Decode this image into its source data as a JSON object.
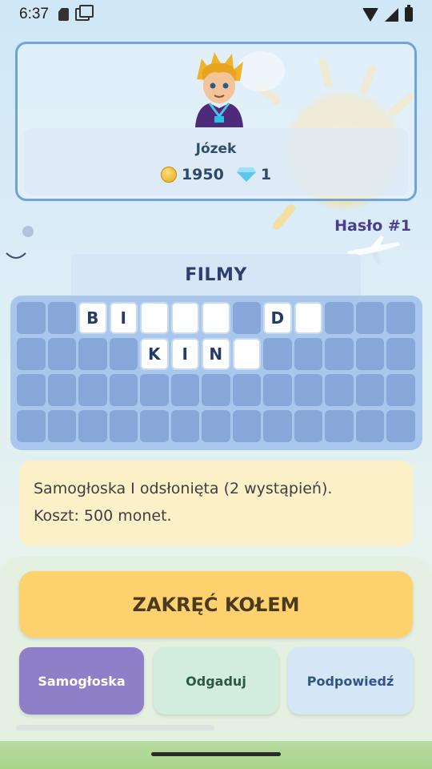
{
  "status_bar": {
    "time": "6:37"
  },
  "profile": {
    "name": "Józek",
    "coins": "1950",
    "gems": "1"
  },
  "puzzle": {
    "number_label": "Hasło #1",
    "category": "FILMY",
    "rows": [
      [
        "",
        "",
        "B",
        "I",
        "_",
        "_",
        "_",
        "",
        "D",
        "_",
        "",
        "",
        ""
      ],
      [
        "",
        "",
        "",
        "",
        "K",
        "I",
        "N",
        "_",
        "",
        "",
        "",
        "",
        ""
      ],
      [
        "",
        "",
        "",
        "",
        "",
        "",
        "",
        "",
        "",
        "",
        "",
        "",
        ""
      ],
      [
        "",
        "",
        "",
        "",
        "",
        "",
        "",
        "",
        "",
        "",
        "",
        "",
        ""
      ]
    ]
  },
  "hint": {
    "line1": "Samogłoska I odsłonięta (2 wystąpień).",
    "line2": "Koszt: 500 monet."
  },
  "actions": {
    "spin_label": "ZAKRĘĆ KOŁEM",
    "vowel_label": "Samogłoska",
    "guess_label": "Odgaduj",
    "hint_label": "Podpowiedź"
  },
  "colors": {
    "accent_purple": "#8f7fc9",
    "spin_yellow": "#fdd26e",
    "board_blue": "#a9c7ec",
    "hint_yellow": "#fbf0c8"
  }
}
